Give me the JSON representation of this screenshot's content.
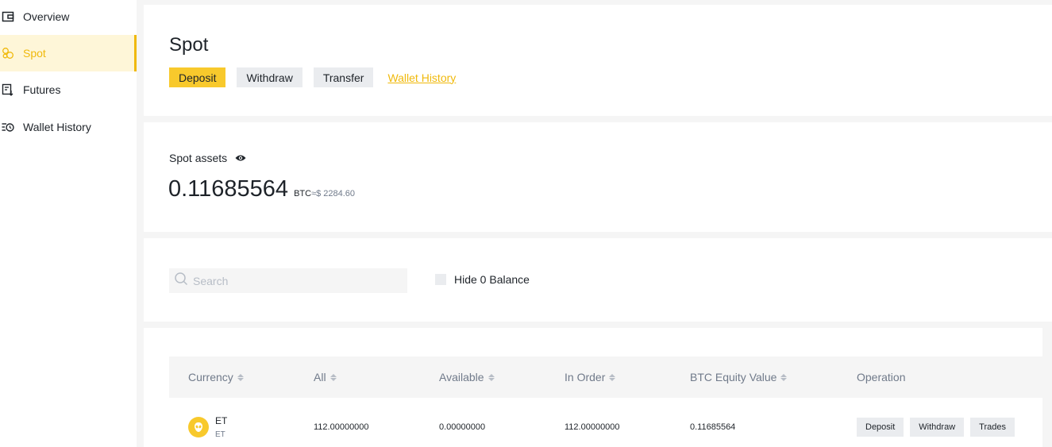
{
  "sidebar": {
    "items": [
      {
        "label": "Overview",
        "icon": "wallet-icon"
      },
      {
        "label": "Spot",
        "icon": "spot-icon",
        "active": true
      },
      {
        "label": "Futures",
        "icon": "futures-icon"
      },
      {
        "label": "Wallet History",
        "icon": "history-icon"
      }
    ]
  },
  "header": {
    "title": "Spot",
    "deposit_label": "Deposit",
    "withdraw_label": "Withdraw",
    "transfer_label": "Transfer",
    "history_link": "Wallet History"
  },
  "assets": {
    "label": "Spot assets",
    "value": "0.11685564",
    "unit": "BTC",
    "approx": "≈$ 2284.60"
  },
  "filters": {
    "search_placeholder": "Search",
    "hide_zero_label": "Hide 0 Balance"
  },
  "table": {
    "columns": [
      "Currency",
      "All",
      "Available",
      "In Order",
      "BTC Equity Value",
      "Operation"
    ],
    "rows": [
      {
        "symbol": "ET",
        "name": "ET",
        "all": "112.00000000",
        "available": "0.00000000",
        "in_order": "112.00000000",
        "btc_value": "0.11685564",
        "ops": [
          "Deposit",
          "Withdraw",
          "Trades"
        ]
      }
    ]
  },
  "colors": {
    "accent": "#f0b90b",
    "active_bg": "#fef6d8",
    "button_bg": "#eaecef"
  }
}
